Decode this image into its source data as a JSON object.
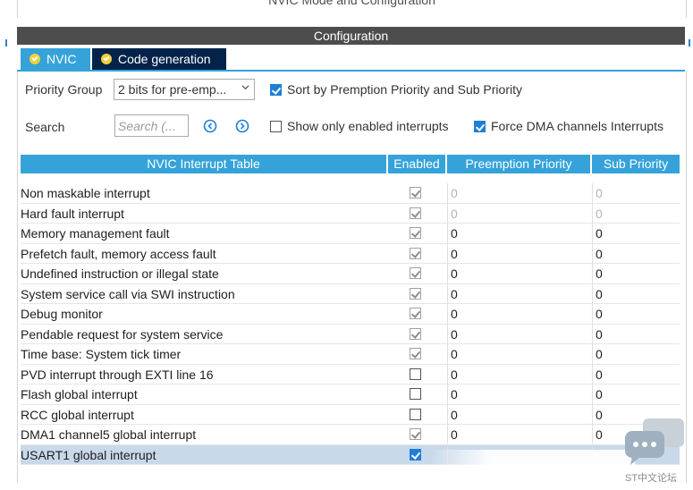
{
  "mode_header": {
    "title": "NVIC Mode and Configuration"
  },
  "config_bar": {
    "title": "Configuration"
  },
  "tabs": [
    {
      "label": "NVIC",
      "active": true
    },
    {
      "label": "Code generation",
      "active": false
    }
  ],
  "priority_group": {
    "label": "Priority Group",
    "value": "2 bits for pre-emp..."
  },
  "sort_option": {
    "label": "Sort by Premption Priority and Sub Priority",
    "checked": true
  },
  "search": {
    "label": "Search",
    "placeholder": "Search (..."
  },
  "show_enabled": {
    "label": "Show only enabled interrupts",
    "checked": false
  },
  "force_dma": {
    "label": "Force DMA channels Interrupts",
    "checked": true
  },
  "table": {
    "headers": {
      "name": "NVIC Interrupt Table",
      "enabled": "Enabled",
      "preemption": "Preemption Priority",
      "sub": "Sub Priority"
    },
    "rows": [
      {
        "name": "Non maskable interrupt",
        "enabled": true,
        "locked": true,
        "preemption": "0",
        "sub": "0",
        "dim": true
      },
      {
        "name": "Hard fault interrupt",
        "enabled": true,
        "locked": true,
        "preemption": "0",
        "sub": "0",
        "dim": true
      },
      {
        "name": "Memory management fault",
        "enabled": true,
        "locked": true,
        "preemption": "0",
        "sub": "0",
        "dim": false
      },
      {
        "name": "Prefetch fault, memory access fault",
        "enabled": true,
        "locked": true,
        "preemption": "0",
        "sub": "0",
        "dim": false
      },
      {
        "name": "Undefined instruction or illegal state",
        "enabled": true,
        "locked": true,
        "preemption": "0",
        "sub": "0",
        "dim": false
      },
      {
        "name": "System service call via SWI instruction",
        "enabled": true,
        "locked": true,
        "preemption": "0",
        "sub": "0",
        "dim": false
      },
      {
        "name": "Debug monitor",
        "enabled": true,
        "locked": true,
        "preemption": "0",
        "sub": "0",
        "dim": false
      },
      {
        "name": "Pendable request for system service",
        "enabled": true,
        "locked": true,
        "preemption": "0",
        "sub": "0",
        "dim": false
      },
      {
        "name": "Time base: System tick timer",
        "enabled": true,
        "locked": true,
        "preemption": "0",
        "sub": "0",
        "dim": false
      },
      {
        "name": "PVD interrupt through EXTI line 16",
        "enabled": false,
        "locked": false,
        "preemption": "0",
        "sub": "0",
        "dim": false
      },
      {
        "name": "Flash global interrupt",
        "enabled": false,
        "locked": false,
        "preemption": "0",
        "sub": "0",
        "dim": false
      },
      {
        "name": "RCC global interrupt",
        "enabled": false,
        "locked": false,
        "preemption": "0",
        "sub": "0",
        "dim": false
      },
      {
        "name": "DMA1 channel5 global interrupt",
        "enabled": true,
        "locked": true,
        "preemption": "0",
        "sub": "0",
        "dim": false
      },
      {
        "name": "USART1 global interrupt",
        "enabled": true,
        "locked": false,
        "preemption": "",
        "sub": "",
        "dim": false,
        "selected": true
      }
    ]
  },
  "watermark": {
    "text": "ST中文论坛"
  },
  "colors": {
    "accent": "#35a3d9",
    "dark_tab": "#03234b",
    "config_bar": "#4d4d4d",
    "selected_row": "#c9d9ea"
  }
}
